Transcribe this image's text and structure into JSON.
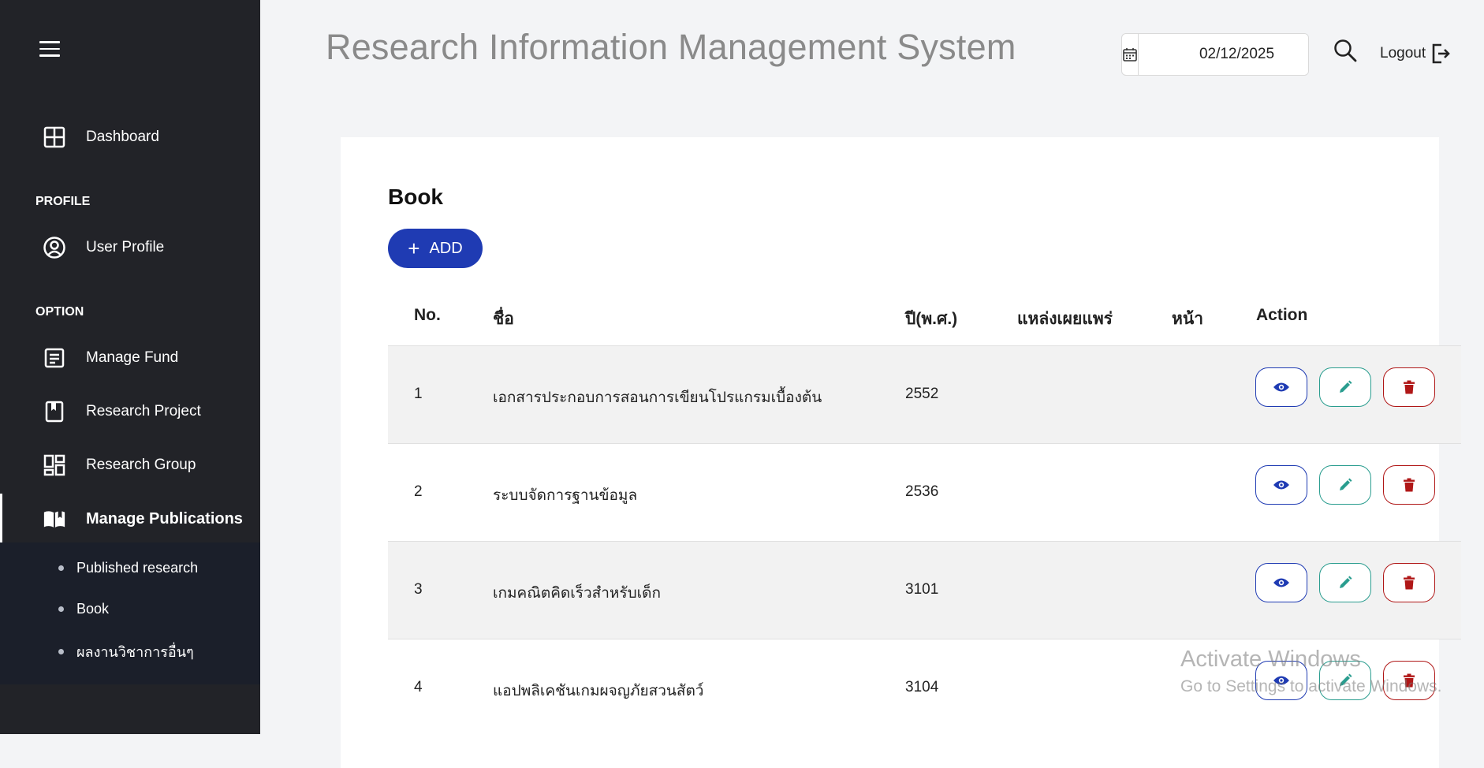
{
  "app": {
    "title": "Research Information Management System"
  },
  "header": {
    "date_value": "02/12/2025",
    "logout_label": "Logout"
  },
  "sidebar": {
    "dashboard": "Dashboard",
    "profile_section": "PROFILE",
    "user_profile": "User Profile",
    "option_section": "OPTION",
    "manage_fund": "Manage Fund",
    "research_project": "Research Project",
    "research_group": "Research Group",
    "manage_publications": "Manage Publications",
    "sub_items": [
      "Published research",
      "Book",
      "ผลงานวิชาการอื่นๆ"
    ]
  },
  "page": {
    "title": "Book",
    "add_label": "ADD",
    "columns": [
      "No.",
      "ชื่อ",
      "ปี(พ.ศ.)",
      "แหล่งเผยแพร่",
      "หน้า",
      "Action"
    ],
    "rows": [
      {
        "no": "1",
        "name": "เอกสารประกอบการสอนการเขียนโปรแกรมเบื้องต้น",
        "year": "2552",
        "source": "",
        "page": ""
      },
      {
        "no": "2",
        "name": "ระบบจัดการฐานข้อมูล",
        "year": "2536",
        "source": "",
        "page": ""
      },
      {
        "no": "3",
        "name": "เกมคณิตคิดเร็วสำหรับเด็ก",
        "year": "3101",
        "source": "",
        "page": ""
      },
      {
        "no": "4",
        "name": "แอปพลิเคชันเกมผจญภัยสวนสัตว์",
        "year": "3104",
        "source": "",
        "page": ""
      }
    ]
  },
  "watermark": {
    "line1": "Activate Windows",
    "line2": "Go to Settings to activate Windows."
  },
  "colors": {
    "sidebar_bg": "#222328",
    "submenu_bg": "#1b1f2a",
    "primary": "#1f3bb3",
    "edit": "#2a9d8f",
    "delete": "#b01717"
  }
}
